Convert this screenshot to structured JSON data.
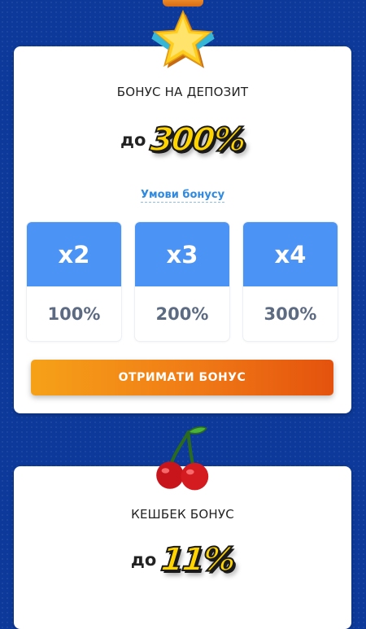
{
  "colors": {
    "background": "#0d3a9a",
    "card": "#ffffff",
    "tier_header": "#4b93f4",
    "tier_percent_text": "#5d6b82",
    "link": "#2f8ae0",
    "cta_gradient_start": "#f6a118",
    "cta_gradient_end": "#e4520d",
    "big_value": "#ffd400"
  },
  "deposit_bonus": {
    "icon": "star-icon",
    "title": "БОНУС НА ДЕПОЗИТ",
    "prefix": "до",
    "value": "300%",
    "terms_link": "Умови бонусу",
    "tiers": [
      {
        "multiplier": "x2",
        "percent": "100%"
      },
      {
        "multiplier": "x3",
        "percent": "200%"
      },
      {
        "multiplier": "x4",
        "percent": "300%"
      }
    ],
    "cta_label": "ОТРИМАТИ БОНУС"
  },
  "cashback_bonus": {
    "icon": "cherry-icon",
    "title": "КЕШБЕК БОНУС",
    "prefix": "до",
    "value": "11%"
  }
}
